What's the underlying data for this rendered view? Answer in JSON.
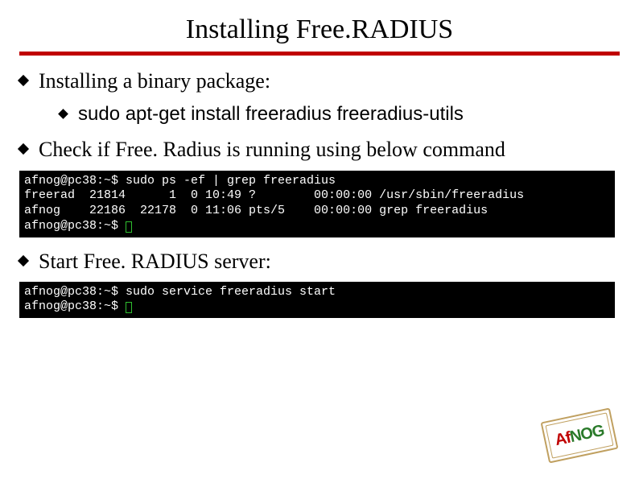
{
  "title": "Installing Free.RADIUS",
  "bullets": {
    "b1": "Installing a binary package:",
    "b1a": "sudo apt-get install freeradius freeradius-utils",
    "b2": "Check if Free. Radius is running using below command",
    "b3": "Start Free. RADIUS server:"
  },
  "terminal1": {
    "l1": "afnog@pc38:~$ sudo ps -ef | grep freeradius",
    "l2": "freerad  21814      1  0 10:49 ?        00:00:00 /usr/sbin/freeradius",
    "l3": "afnog    22186  22178  0 11:06 pts/5    00:00:00 grep freeradius",
    "l4": "afnog@pc38:~$"
  },
  "terminal2": {
    "l1": "afnog@pc38:~$ sudo service freeradius start",
    "l2": "afnog@pc38:~$"
  },
  "logo": {
    "af": "Af",
    "nog": "NOG"
  },
  "colors": {
    "accent_red": "#c00000",
    "accent_green": "#2a7a2a",
    "stamp_border": "#c0a060"
  }
}
